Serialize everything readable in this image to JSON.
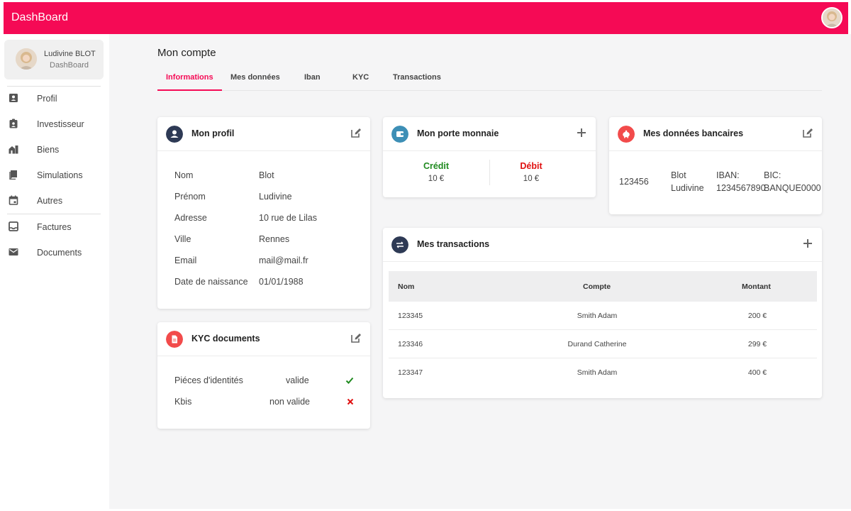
{
  "app": {
    "title": "DashBoard"
  },
  "user": {
    "name": "Ludivine BLOT",
    "subtitle": "DashBoard"
  },
  "sidebar": {
    "items": [
      {
        "label": "Profil",
        "icon": "account-box-icon"
      },
      {
        "label": "Investisseur",
        "icon": "badge-icon"
      },
      {
        "label": "Biens",
        "icon": "buildings-icon"
      },
      {
        "label": "Simulations",
        "icon": "book-icon"
      },
      {
        "label": "Autres",
        "icon": "calendar-icon"
      },
      {
        "label": "Factures",
        "icon": "inbox-icon"
      },
      {
        "label": "Documents",
        "icon": "mail-icon"
      }
    ]
  },
  "page": {
    "title": "Mon compte",
    "tabs": [
      "Informations",
      "Mes données",
      "Iban",
      "KYC",
      "Transactions"
    ],
    "active_tab": "Informations"
  },
  "profile": {
    "title": "Mon profil",
    "rows": [
      {
        "label": "Nom",
        "value": "Blot"
      },
      {
        "label": "Prénom",
        "value": "Ludivine"
      },
      {
        "label": "Adresse",
        "value": "10 rue de Lilas"
      },
      {
        "label": "Ville",
        "value": "Rennes"
      },
      {
        "label": "Email",
        "value": "mail@mail.fr"
      },
      {
        "label": "Date de naissance",
        "value": "01/01/1988"
      }
    ]
  },
  "wallet": {
    "title": "Mon porte monnaie",
    "credit_label": "Crédit",
    "credit_value": "10 €",
    "debit_label": "Débit",
    "debit_value": "10 €"
  },
  "bank": {
    "title": "Mes données bancaires",
    "number": "123456",
    "holder_line1": "Blot",
    "holder_line2": "Ludivine",
    "iban_label": "IBAN:",
    "iban_value": "1234567890",
    "bic_label": "BIC:",
    "bic_value": "BANQUE0000"
  },
  "kyc": {
    "title": "KYC documents",
    "rows": [
      {
        "label": "Piéces d'identités",
        "status": "valide",
        "ok": true
      },
      {
        "label": "Kbis",
        "status": "non valide",
        "ok": false
      }
    ]
  },
  "transactions": {
    "title": "Mes transactions",
    "headers": {
      "nom": "Nom",
      "compte": "Compte",
      "montant": "Montant"
    },
    "rows": [
      {
        "nom": "123345",
        "compte": "Smith Adam",
        "montant": "200 €"
      },
      {
        "nom": "123346",
        "compte": "Durand Catherine",
        "montant": "299 €"
      },
      {
        "nom": "123347",
        "compte": "Smith Adam",
        "montant": "400 €"
      }
    ]
  },
  "colors": {
    "brand": "#f50a55",
    "credit": "#1f8a1f",
    "debit": "#e01010",
    "profile_icon_bg": "#2e3a55",
    "wallet_icon_bg": "#3d8fb6",
    "bank_icon_bg": "#f24b4b",
    "kyc_icon_bg": "#f24b4b",
    "transactions_icon_bg": "#2e3a55"
  }
}
